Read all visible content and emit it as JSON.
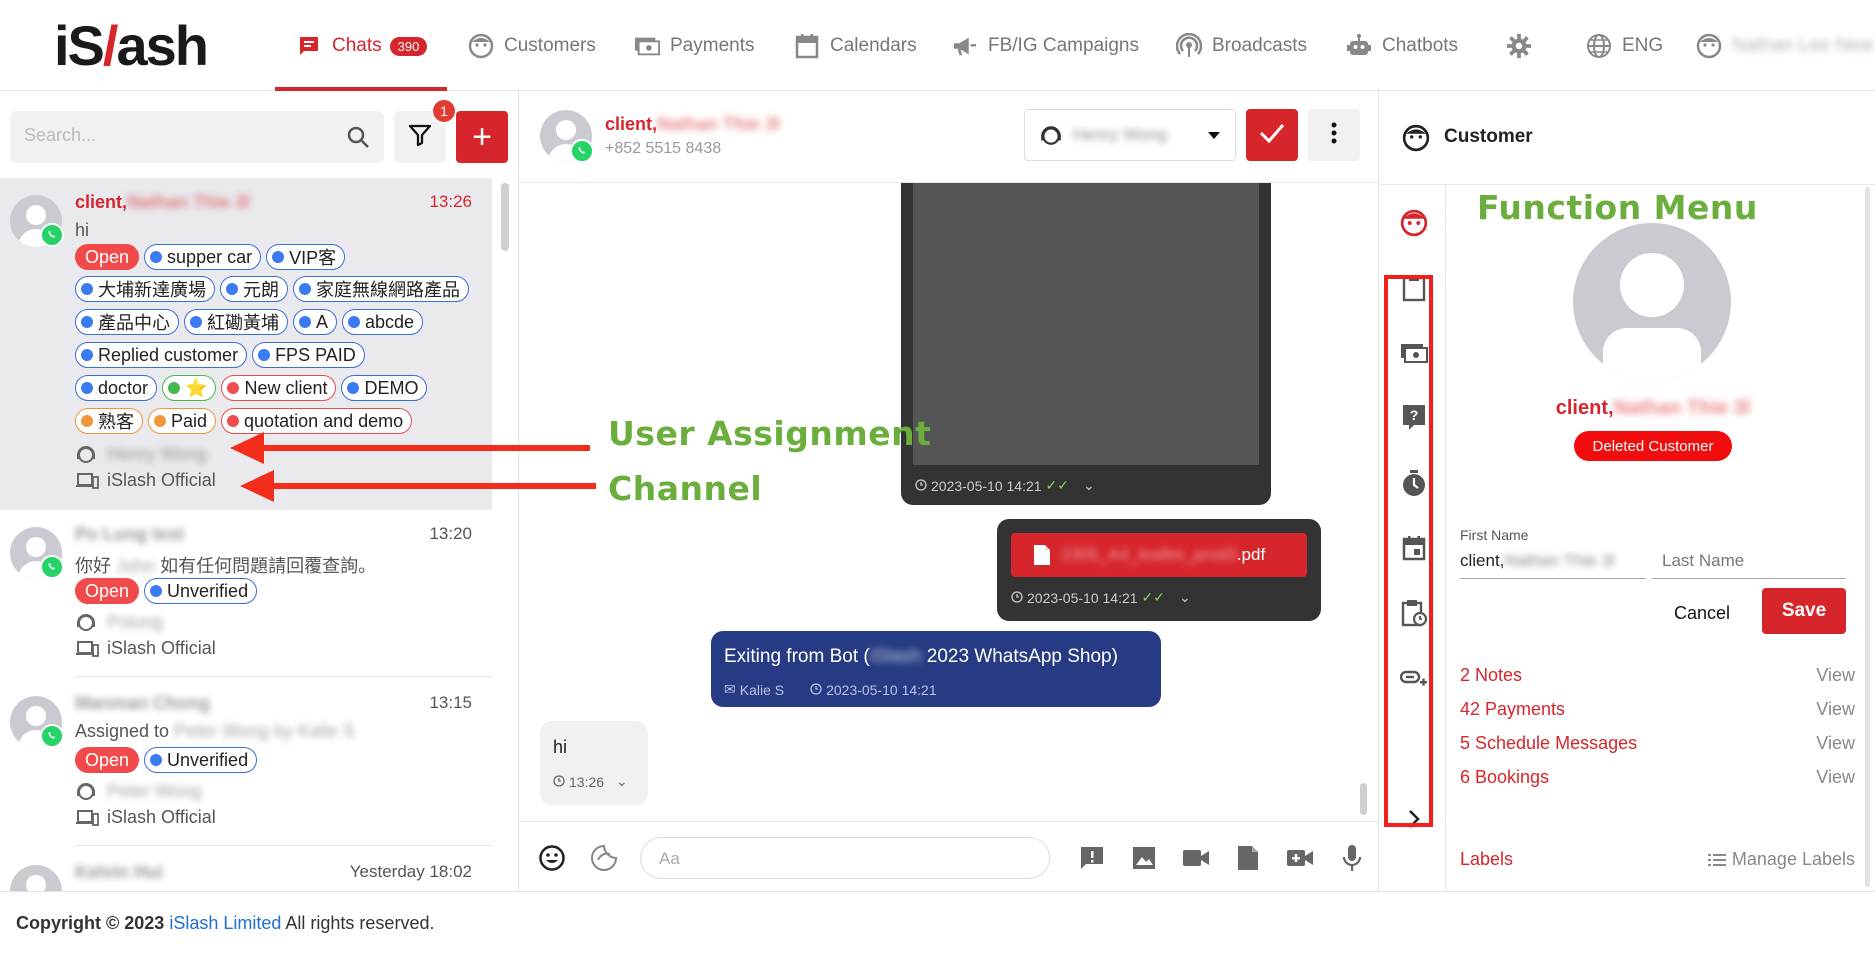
{
  "brand": {
    "logo_left": "iS",
    "logo_slash": "/",
    "logo_right": "ash"
  },
  "nav": {
    "chats": "Chats",
    "chats_badge": "390",
    "customers": "Customers",
    "payments": "Payments",
    "calendars": "Calendars",
    "campaigns": "FB/IG Campaigns",
    "broadcasts": "Broadcasts",
    "chatbots": "Chatbots",
    "language": "ENG",
    "user_name": "Nathan Lee New"
  },
  "left": {
    "search_placeholder": "Search...",
    "filter_badge": "1",
    "add_label": "+",
    "chats": [
      {
        "name_prefix": "client,",
        "name_blur": "Nathan Thie 3l",
        "time": "13:26",
        "message": "hi",
        "status": "Open",
        "tags_row1": [
          "supper car",
          "VIP客"
        ],
        "tags_row2": [
          "大埔新達廣場",
          "元朗",
          "家庭無線網路產品"
        ],
        "tags_row3": [
          "產品中心",
          "紅磡黃埔",
          "A",
          "abcde"
        ],
        "tags_row4": [
          "Replied customer",
          "FPS PAID"
        ],
        "tags_row5": [
          "doctor",
          "⭐",
          "New client",
          "DEMO"
        ],
        "tags_row6": [
          "熟客",
          "Paid",
          "quotation and demo"
        ],
        "agent": "Henry Wong",
        "channel": "iSlash Official"
      },
      {
        "name": "Po Lung test",
        "time": "13:20",
        "message_prefix": "你好",
        "message_blur": "John",
        "message_suffix": "如有任何問題請回覆查詢。",
        "status": "Open",
        "tag": "Unverified",
        "agent": "Polung",
        "channel": "iSlash Official"
      },
      {
        "name": "Manman Chong",
        "time": "13:15",
        "message_prefix": "Assigned to",
        "message_blur": "Peter Wong by Kalie S",
        "status": "Open",
        "tag": "Unverified",
        "agent": "Peter Wong",
        "channel": "iSlash Official"
      },
      {
        "name": "Kelvin Hui",
        "time": "Yesterday 18:02"
      }
    ]
  },
  "convo": {
    "name_prefix": "client,",
    "name_blur": "Nathan Thie 3l",
    "phone": "+852 5515 8438",
    "assignee": "Henry Wong",
    "image_msg_time": "2023-05-10 14:21",
    "pdf_blur": "2305_A4_leaflet_prod3",
    "pdf_ext": ".pdf",
    "pdf_time": "2023-05-10 14:21",
    "bot_prefix": "Exiting from Bot (",
    "bot_blur": "iSlash",
    "bot_suffix": " 2023 WhatsApp Shop)",
    "bot_sender": "Kalie S",
    "bot_time": "2023-05-10 14:21",
    "in_text": "hi",
    "in_time": "13:26",
    "composer_placeholder": "Aa"
  },
  "right": {
    "title": "Customer",
    "name_prefix": "client,",
    "name_blur": "Nathan Thie 3l",
    "deleted_badge": "Deleted Customer",
    "first_name_label": "First Name",
    "first_name_value_prefix": "client,",
    "first_name_value_blur": "Nathan Thie 3l",
    "last_name_placeholder": "Last Name",
    "cancel": "Cancel",
    "save": "Save",
    "links": [
      {
        "label": "2 Notes",
        "action": "View"
      },
      {
        "label": "42 Payments",
        "action": "View"
      },
      {
        "label": "5 Schedule Messages",
        "action": "View"
      },
      {
        "label": "6 Bookings",
        "action": "View"
      }
    ],
    "labels_title": "Labels",
    "manage_labels": "Manage Labels"
  },
  "annotations": {
    "function_menu": "Function Menu",
    "user_assignment": "User Assignment",
    "channel": "Channel"
  },
  "footer": {
    "copyright": "Copyright © 2023",
    "company": "iSlash Limited",
    "rights": "All rights reserved."
  },
  "colors": {
    "brand_red": "#d6262b",
    "annotation_green": "#6cae3d",
    "arrow_red": "#f22d1b",
    "bot_blue": "#263b83"
  }
}
